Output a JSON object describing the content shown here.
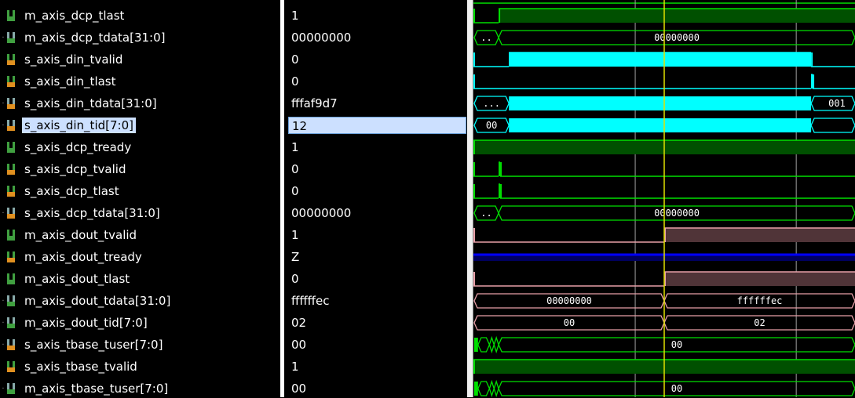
{
  "colors": {
    "green": "#00e000",
    "green_fill": "#005000",
    "cyan": "#00ffff",
    "pink": "#e8a0a8",
    "pink_fill": "#503438",
    "blue": "#0000ff",
    "blue_fill": "#000060",
    "cursor": "#e0e000",
    "grid": "#a0a0a0",
    "orange_icon": "#e09020",
    "green_icon": "#40a040"
  },
  "time_range": [
    0,
    100
  ],
  "cursor_time": 50,
  "grid_times": [
    42.4,
    84.6
  ],
  "selected_index": 5,
  "signals": [
    {
      "name": "m_axis_dcp_tlast",
      "value": "1",
      "bus": false,
      "dir": "out",
      "color": "green",
      "wave": [
        {
          "t0": 0,
          "t1": 6.6,
          "v": 0
        },
        {
          "t0": 6.6,
          "t1": 100,
          "v": 1
        }
      ]
    },
    {
      "name": "m_axis_dcp_tdata[31:0]",
      "value": "00000000",
      "bus": true,
      "dir": "out",
      "color": "green",
      "wave": [
        {
          "t0": 0,
          "t1": 6.6,
          "label": ".."
        },
        {
          "t0": 6.6,
          "t1": 100,
          "label": "00000000"
        }
      ]
    },
    {
      "name": "s_axis_din_tvalid",
      "value": "0",
      "bus": false,
      "dir": "in",
      "color": "cyan",
      "wave": [
        {
          "t0": 0,
          "t1": 9.3,
          "v": 0
        },
        {
          "t0": 9.3,
          "t1": 88.5,
          "v": 1
        },
        {
          "t0": 88.5,
          "t1": 100,
          "v": 0
        }
      ]
    },
    {
      "name": "s_axis_din_tlast",
      "value": "0",
      "bus": false,
      "dir": "in",
      "color": "cyan",
      "wave": [
        {
          "t0": 0,
          "t1": 88.5,
          "v": 0
        },
        {
          "t0": 88.5,
          "t1": 88.9,
          "v": 1
        },
        {
          "t0": 88.9,
          "t1": 100,
          "v": 0
        }
      ]
    },
    {
      "name": "s_axis_din_tdata[31:0]",
      "value": "fffaf9d7",
      "bus": true,
      "dir": "in",
      "color": "cyan",
      "wave": [
        {
          "t0": 0,
          "t1": 9.3,
          "label": "..."
        },
        {
          "t0": 9.3,
          "t1": 88.5,
          "dense": true
        },
        {
          "t0": 88.5,
          "t1": 100,
          "label": "001"
        }
      ]
    },
    {
      "name": "s_axis_din_tid[7:0]",
      "value": "12",
      "bus": true,
      "dir": "in",
      "color": "cyan",
      "wave": [
        {
          "t0": 0,
          "t1": 9.3,
          "label": "00"
        },
        {
          "t0": 9.3,
          "t1": 88.5,
          "dense": true
        },
        {
          "t0": 88.5,
          "t1": 100,
          "label": ""
        }
      ]
    },
    {
      "name": "s_axis_dcp_tready",
      "value": "1",
      "bus": false,
      "dir": "out",
      "color": "green",
      "wave": [
        {
          "t0": 0,
          "t1": 100,
          "v": 1
        }
      ]
    },
    {
      "name": "s_axis_dcp_tvalid",
      "value": "0",
      "bus": false,
      "dir": "in",
      "color": "green",
      "wave": [
        {
          "t0": 0,
          "t1": 6.6,
          "v": 0
        },
        {
          "t0": 6.6,
          "t1": 7.0,
          "v": 1
        },
        {
          "t0": 7.0,
          "t1": 100,
          "v": 0
        }
      ]
    },
    {
      "name": "s_axis_dcp_tlast",
      "value": "0",
      "bus": false,
      "dir": "in",
      "color": "green",
      "wave": [
        {
          "t0": 0,
          "t1": 6.6,
          "v": 0
        },
        {
          "t0": 6.6,
          "t1": 7.0,
          "v": 1
        },
        {
          "t0": 7.0,
          "t1": 100,
          "v": 0
        }
      ]
    },
    {
      "name": "s_axis_dcp_tdata[31:0]",
      "value": "00000000",
      "bus": true,
      "dir": "in",
      "color": "green",
      "wave": [
        {
          "t0": 0,
          "t1": 6.6,
          "label": ".."
        },
        {
          "t0": 6.6,
          "t1": 100,
          "label": "00000000"
        }
      ]
    },
    {
      "name": "m_axis_dout_tvalid",
      "value": "1",
      "bus": false,
      "dir": "out",
      "color": "pink",
      "wave": [
        {
          "t0": 0,
          "t1": 50,
          "v": 0
        },
        {
          "t0": 50,
          "t1": 100,
          "v": 1
        }
      ]
    },
    {
      "name": "m_axis_dout_tready",
      "value": "Z",
      "bus": false,
      "dir": "in",
      "color": "blue",
      "wave": [
        {
          "t0": 0,
          "t1": 100,
          "v": "z"
        }
      ]
    },
    {
      "name": "m_axis_dout_tlast",
      "value": "0",
      "bus": false,
      "dir": "out",
      "color": "pink",
      "wave": [
        {
          "t0": 0,
          "t1": 50,
          "v": 0
        },
        {
          "t0": 50,
          "t1": 100,
          "v": 1
        }
      ]
    },
    {
      "name": "m_axis_dout_tdata[31:0]",
      "value": "ffffffec",
      "bus": true,
      "dir": "out",
      "color": "pink",
      "wave": [
        {
          "t0": 0,
          "t1": 50,
          "label": "00000000"
        },
        {
          "t0": 50,
          "t1": 100,
          "label": "ffffffec"
        }
      ]
    },
    {
      "name": "m_axis_dout_tid[7:0]",
      "value": "02",
      "bus": true,
      "dir": "out",
      "color": "pink",
      "wave": [
        {
          "t0": 0,
          "t1": 50,
          "label": "00"
        },
        {
          "t0": 50,
          "t1": 100,
          "label": "02"
        }
      ]
    },
    {
      "name": "s_axis_tbase_tuser[7:0]",
      "value": "00",
      "bus": true,
      "dir": "in",
      "color": "green",
      "wave": [
        {
          "t0": 0,
          "t1": 1.2,
          "dense": true
        },
        {
          "t0": 1.2,
          "t1": 4.2,
          "label": ""
        },
        {
          "t0": 4.2,
          "t1": 5.4,
          "label": ""
        },
        {
          "t0": 5.4,
          "t1": 6.6,
          "label": ""
        },
        {
          "t0": 6.6,
          "t1": 100,
          "label": "00"
        }
      ]
    },
    {
      "name": "s_axis_tbase_tvalid",
      "value": "1",
      "bus": false,
      "dir": "in",
      "color": "green",
      "wave": [
        {
          "t0": 0,
          "t1": 100,
          "v": 1
        }
      ]
    },
    {
      "name": "m_axis_tbase_tuser[7:0]",
      "value": "00",
      "bus": true,
      "dir": "out",
      "color": "green",
      "wave": [
        {
          "t0": 0,
          "t1": 1.2,
          "dense": true
        },
        {
          "t0": 1.2,
          "t1": 4.2,
          "label": ""
        },
        {
          "t0": 4.2,
          "t1": 5.4,
          "label": ""
        },
        {
          "t0": 5.4,
          "t1": 6.6,
          "label": ""
        },
        {
          "t0": 6.6,
          "t1": 100,
          "label": "00"
        }
      ]
    }
  ]
}
